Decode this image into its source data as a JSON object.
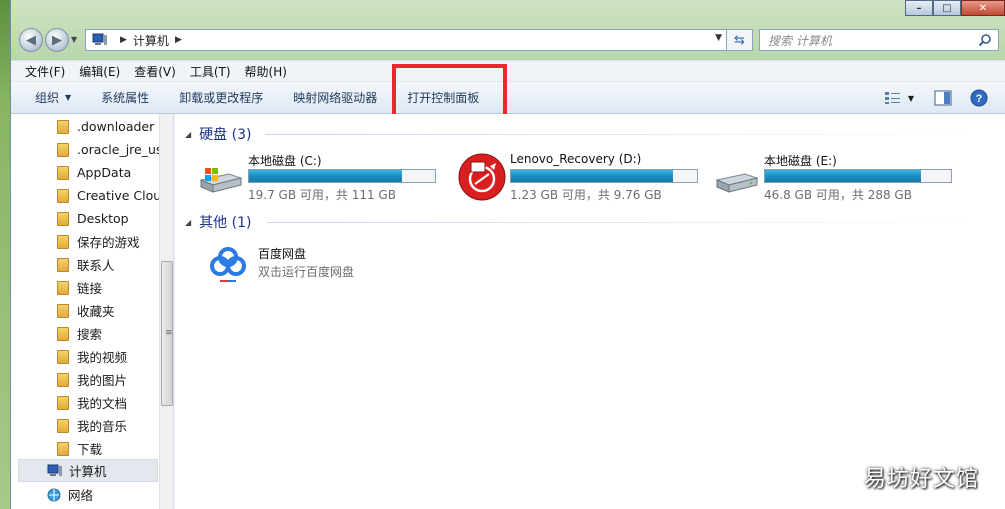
{
  "window": {
    "controls": {
      "minimize": "–",
      "maximize": "□",
      "close": "✕"
    }
  },
  "address": {
    "path": "计算机",
    "search_placeholder": "搜索 计算机"
  },
  "menu": [
    "文件(F)",
    "编辑(E)",
    "查看(V)",
    "工具(T)",
    "帮助(H)"
  ],
  "commands": {
    "organize": "组织",
    "system_properties": "系统属性",
    "uninstall": "卸载或更改程序",
    "map_drive": "映射网络驱动器",
    "open_control_panel": "打开控制面板"
  },
  "nav": {
    "items": [
      ".downloader",
      ".oracle_jre_usa",
      "AppData",
      "Creative Cloud",
      "Desktop",
      "保存的游戏",
      "联系人",
      "链接",
      "收藏夹",
      "搜索",
      "我的视频",
      "我的图片",
      "我的文档",
      "我的音乐",
      "下载"
    ],
    "computer": "计算机",
    "network": "网络"
  },
  "groups": {
    "hdd": "硬盘 (3)",
    "other": "其他 (1)"
  },
  "drives": [
    {
      "name": "本地磁盘 (C:)",
      "info": "19.7 GB 可用，共 111 GB",
      "used_fraction": 0.82,
      "icon": "hard-drive-windows-icon"
    },
    {
      "name": "Lenovo_Recovery (D:)",
      "info": "1.23 GB 可用，共 9.76 GB",
      "used_fraction": 0.87,
      "icon": "lenovo-recovery-icon"
    },
    {
      "name": "本地磁盘 (E:)",
      "info": "46.8 GB 可用，共 288 GB",
      "used_fraction": 0.84,
      "icon": "hard-drive-icon"
    }
  ],
  "other": {
    "name": "百度网盘",
    "desc": "双击运行百度网盘"
  },
  "watermark": "易坊好文馆",
  "colors": {
    "accent_red": "#e8282c",
    "bar_blue": "#1d8fc2",
    "group_blue": "#1e3287"
  }
}
